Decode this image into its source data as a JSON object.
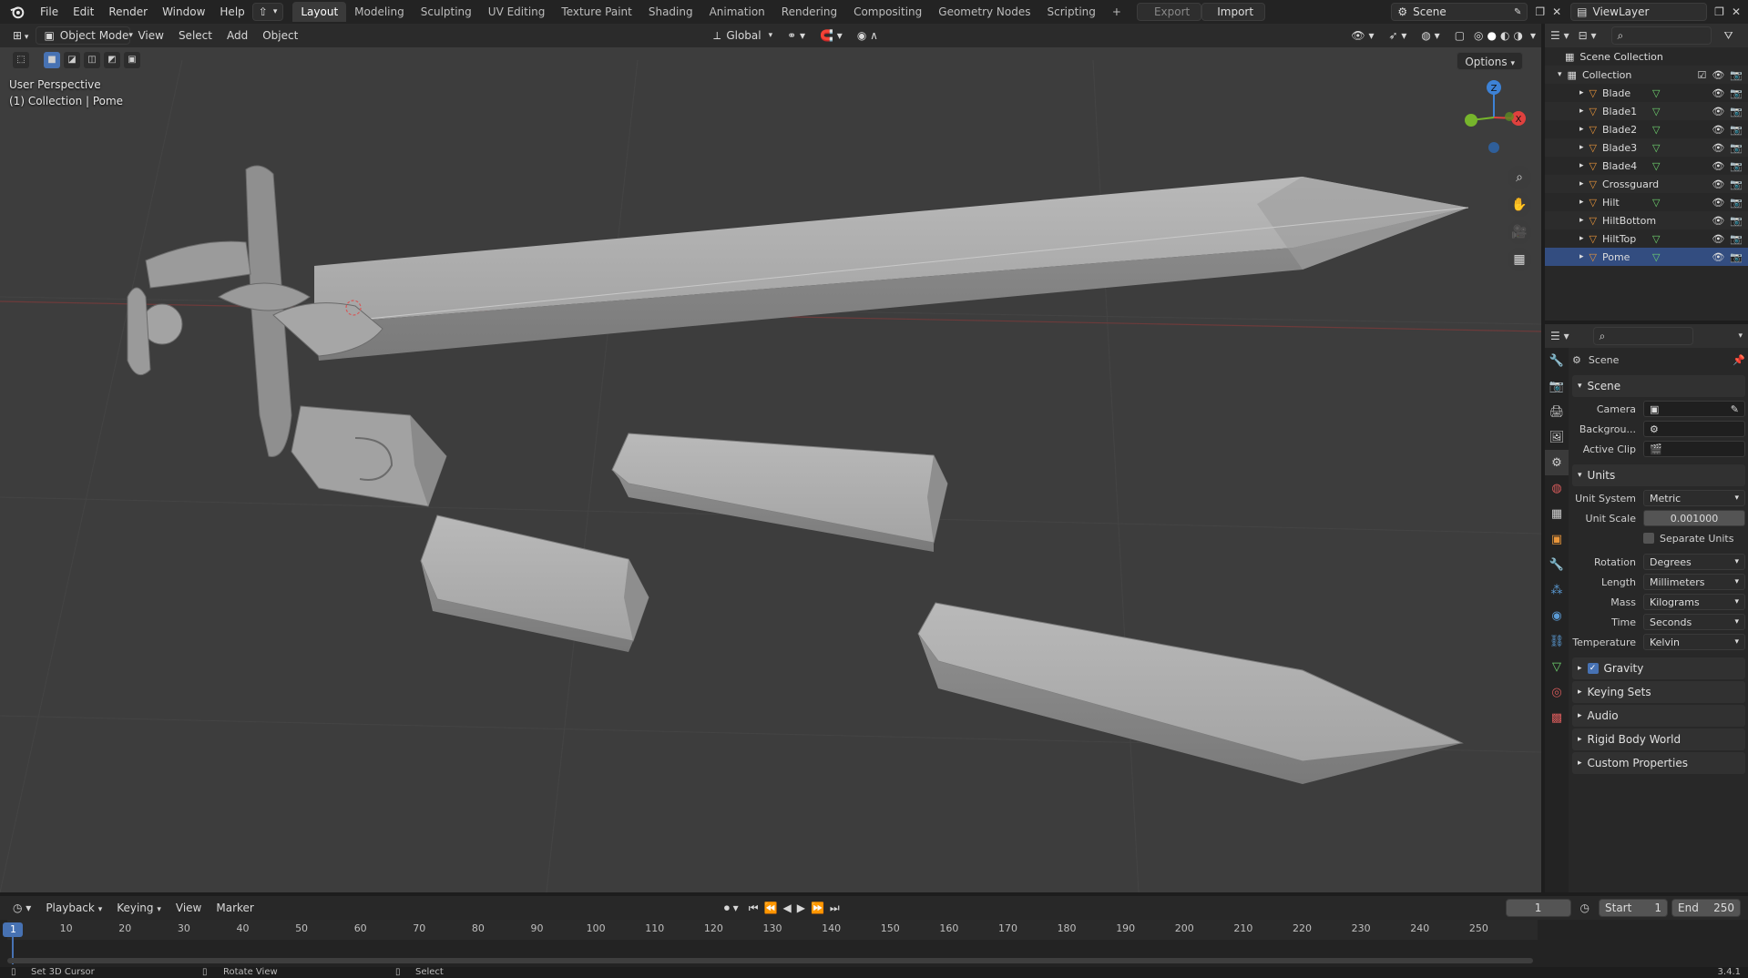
{
  "topbar": {
    "menus": [
      "File",
      "Edit",
      "Render",
      "Window",
      "Help"
    ],
    "workspaces": [
      "Layout",
      "Modeling",
      "Sculpting",
      "UV Editing",
      "Texture Paint",
      "Shading",
      "Animation",
      "Rendering",
      "Compositing",
      "Geometry Nodes",
      "Scripting"
    ],
    "active_workspace": "Layout",
    "export_label": "Export",
    "import_label": "Import",
    "scene_name": "Scene",
    "viewlayer_name": "ViewLayer"
  },
  "viewport": {
    "mode": "Object Mode",
    "menus": [
      "View",
      "Select",
      "Add",
      "Object"
    ],
    "transform_orientation": "Global",
    "options_label": "Options",
    "overlay_line1": "User Perspective",
    "overlay_line2": "(1) Collection | Pome",
    "gizmo_axes": {
      "z": "Z",
      "x": "X"
    }
  },
  "outliner": {
    "root": "Scene Collection",
    "collection": "Collection",
    "items": [
      {
        "name": "Blade",
        "mesh": true
      },
      {
        "name": "Blade1",
        "mesh": true
      },
      {
        "name": "Blade2",
        "mesh": true
      },
      {
        "name": "Blade3",
        "mesh": true
      },
      {
        "name": "Blade4",
        "mesh": true
      },
      {
        "name": "Crossguard",
        "mesh": false
      },
      {
        "name": "Hilt",
        "mesh": true
      },
      {
        "name": "HiltBottom",
        "mesh": false
      },
      {
        "name": "HiltTop",
        "mesh": true
      },
      {
        "name": "Pome",
        "mesh": true
      }
    ]
  },
  "properties": {
    "context_title": "Scene",
    "scene_panel": "Scene",
    "camera_label": "Camera",
    "background_label": "Backgrou...",
    "active_clip_label": "Active Clip",
    "units_panel": "Units",
    "unit_system_label": "Unit System",
    "unit_system_value": "Metric",
    "unit_scale_label": "Unit Scale",
    "unit_scale_value": "0.001000",
    "separate_units_label": "Separate Units",
    "rotation_label": "Rotation",
    "rotation_value": "Degrees",
    "length_label": "Length",
    "length_value": "Millimeters",
    "mass_label": "Mass",
    "mass_value": "Kilograms",
    "time_label": "Time",
    "time_value": "Seconds",
    "temperature_label": "Temperature",
    "temperature_value": "Kelvin",
    "gravity_label": "Gravity",
    "keying_sets_label": "Keying Sets",
    "audio_label": "Audio",
    "rigid_body_label": "Rigid Body World",
    "custom_props_label": "Custom Properties"
  },
  "timeline": {
    "menus": [
      "Playback",
      "Keying",
      "View",
      "Marker"
    ],
    "current_frame": "1",
    "start_label": "Start",
    "start_value": "1",
    "end_label": "End",
    "end_value": "250",
    "ticks": [
      10,
      20,
      30,
      40,
      50,
      60,
      70,
      80,
      90,
      100,
      110,
      120,
      130,
      140,
      150,
      160,
      170,
      180,
      190,
      200,
      210,
      220,
      230,
      240,
      250
    ]
  },
  "statusbar": {
    "hint1": "Set 3D Cursor",
    "hint2": "Rotate View",
    "hint3": "Select",
    "version": "3.4.1"
  },
  "colors": {
    "accent": "#4772b3",
    "object_orange": "#e8953a",
    "mesh_green": "#6fd46f",
    "axis_x": "#e0413e",
    "axis_y": "#76b52c",
    "axis_z": "#3d82d6"
  }
}
